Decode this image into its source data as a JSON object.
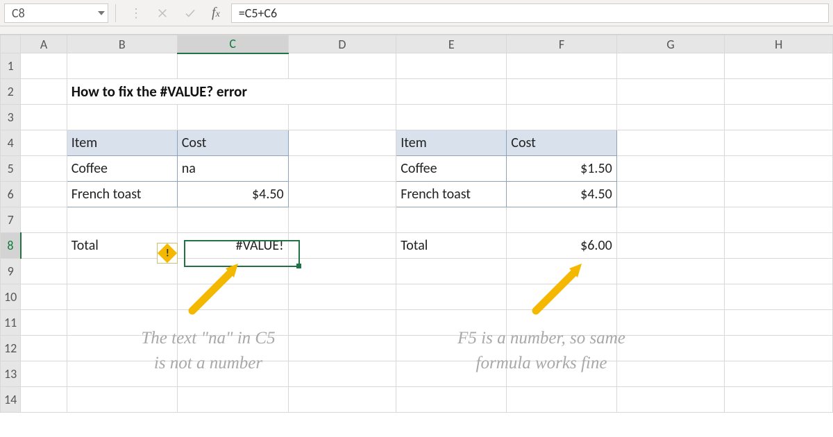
{
  "namebox": "C8",
  "formula": "=C5+C6",
  "columns": [
    "A",
    "B",
    "C",
    "D",
    "E",
    "F",
    "G",
    "H"
  ],
  "rows": [
    "1",
    "2",
    "3",
    "4",
    "5",
    "6",
    "7",
    "8",
    "9",
    "10",
    "11",
    "12",
    "13",
    "14"
  ],
  "title": "How to fix the #VALUE? error",
  "table1": {
    "h1": "Item",
    "h2": "Cost",
    "r1c1": "Coffee",
    "r1c2": "na",
    "r2c1": "French toast",
    "r2c2": "$4.50",
    "total_label": "Total",
    "total_value": "#VALUE!"
  },
  "table2": {
    "h1": "Item",
    "h2": "Cost",
    "r1c1": "Coffee",
    "r1c2": "$1.50",
    "r2c1": "French toast",
    "r2c2": "$4.50",
    "total_label": "Total",
    "total_value": "$6.00"
  },
  "note1": "The text \"na\" in C5\nis not a number",
  "note2": "F5 is a number, so same\nformula works fine",
  "colors": {
    "accent": "#217346",
    "arrow": "#f5b800"
  }
}
